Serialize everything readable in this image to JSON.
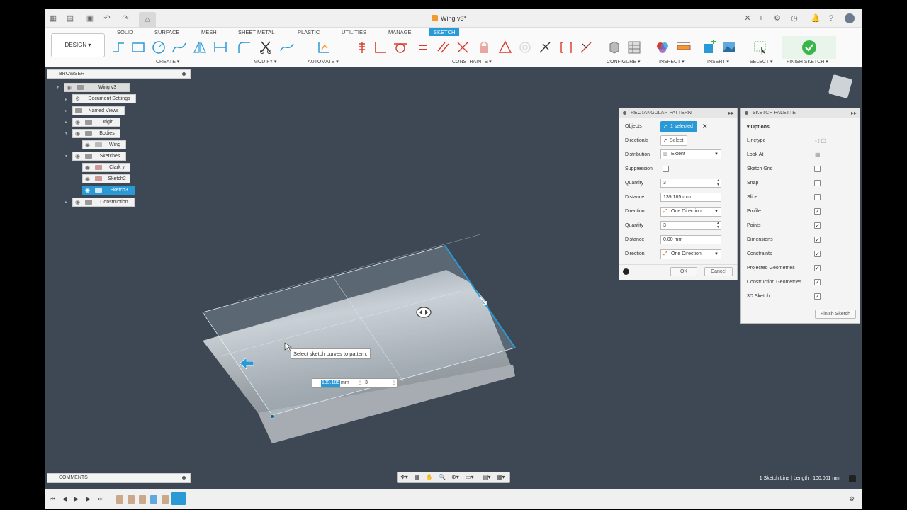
{
  "window": {
    "doc_title": "Wing v3*"
  },
  "workspace": {
    "design_label": "DESIGN"
  },
  "tabs": [
    "SOLID",
    "SURFACE",
    "MESH",
    "SHEET METAL",
    "PLASTIC",
    "UTILITIES",
    "MANAGE",
    "SKETCH"
  ],
  "groups": {
    "create": "CREATE",
    "modify": "MODIFY",
    "automate": "AUTOMATE",
    "constraints": "CONSTRAINTS",
    "configure": "CONFIGURE",
    "inspect": "INSPECT",
    "insert": "INSERT",
    "select": "SELECT",
    "finish": "FINISH SKETCH"
  },
  "browser": {
    "title": "BROWSER",
    "items": [
      {
        "label": "Wing v3"
      },
      {
        "label": "Document Settings"
      },
      {
        "label": "Named Views"
      },
      {
        "label": "Origin"
      },
      {
        "label": "Bodies"
      },
      {
        "label": "Wing"
      },
      {
        "label": "Sketches"
      },
      {
        "label": "Clark y"
      },
      {
        "label": "Sketch2"
      },
      {
        "label": "Sketch3"
      },
      {
        "label": "Construction"
      }
    ]
  },
  "pattern": {
    "title": "RECTANGULAR PATTERN",
    "objects_label": "Objects",
    "objects_value": "1 selected",
    "directions_label": "Direction/s",
    "directions_value": "Select",
    "distribution_label": "Distribution",
    "distribution_value": "Extent",
    "suppression_label": "Suppression",
    "quantity1_label": "Quantity",
    "quantity1_value": "3",
    "distance1_label": "Distance",
    "distance1_value": "139.185 mm",
    "direction1_label": "Direction",
    "direction1_value": "One Direction",
    "quantity2_label": "Quantity",
    "quantity2_value": "3",
    "distance2_label": "Distance",
    "distance2_value": "0.00 mm",
    "direction2_label": "Direction",
    "direction2_value": "One Direction",
    "ok": "OK",
    "cancel": "Cancel"
  },
  "palette": {
    "title": "SKETCH PALETTE",
    "options": "Options",
    "items": [
      {
        "label": "Linetype",
        "checked": null
      },
      {
        "label": "Look At",
        "checked": null
      },
      {
        "label": "Sketch Grid",
        "checked": false
      },
      {
        "label": "Snap",
        "checked": false
      },
      {
        "label": "Slice",
        "checked": false
      },
      {
        "label": "Profile",
        "checked": true
      },
      {
        "label": "Points",
        "checked": true
      },
      {
        "label": "Dimensions",
        "checked": true
      },
      {
        "label": "Constraints",
        "checked": true
      },
      {
        "label": "Projected Geometries",
        "checked": true
      },
      {
        "label": "Construction Geometries",
        "checked": true
      },
      {
        "label": "3D Sketch",
        "checked": true
      }
    ],
    "finish": "Finish Sketch"
  },
  "canvas": {
    "tooltip": "Select sketch curves to pattern.",
    "dim_value": "139.185",
    "dim_unit": "mm",
    "dim_qty": "3"
  },
  "comments": "COMMENTS",
  "status": "1 Sketch Line | Length : 100.001 mm",
  "colors": {
    "accent": "#2a9ad7",
    "viewport": "#3d4854",
    "finish_green": "#3bb54a"
  }
}
